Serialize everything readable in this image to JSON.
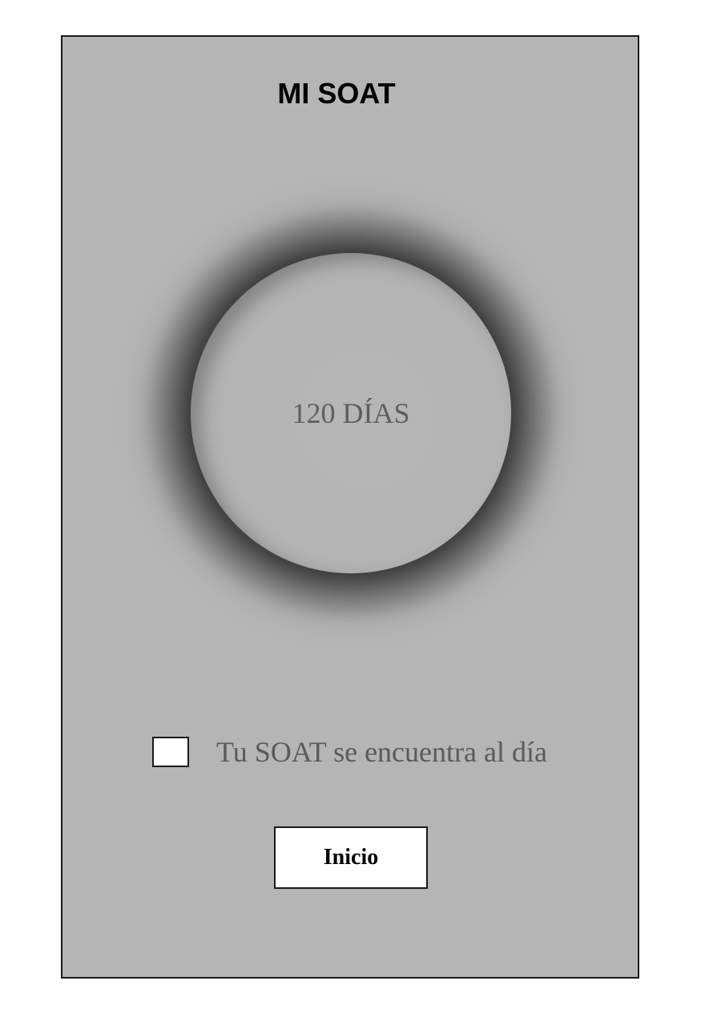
{
  "header": {
    "title": "MI SOAT"
  },
  "counter": {
    "days_label": "120 DÍAS"
  },
  "status": {
    "checked": false,
    "message": "Tu SOAT se encuentra al día"
  },
  "actions": {
    "home_label": "Inicio"
  },
  "colors": {
    "screen_background": "#b5b5b5",
    "ring_dark": "#3a3a3a",
    "button_background": "#ffffff",
    "border": "#1a1a1a"
  }
}
